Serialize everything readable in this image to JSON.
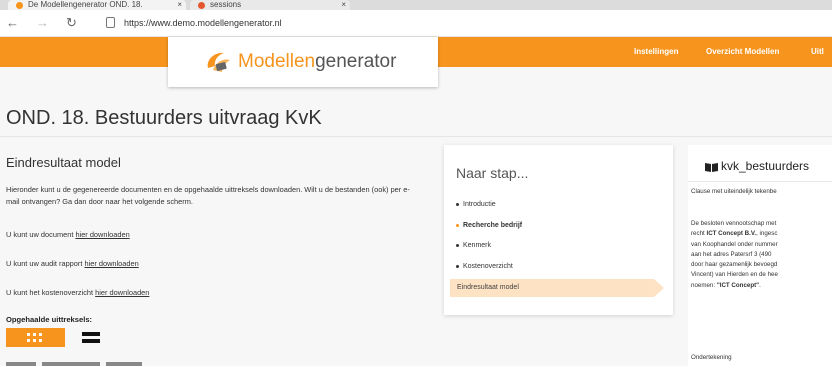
{
  "browser": {
    "tabs": [
      {
        "label": "De Modellengenerator OND. 18."
      },
      {
        "label": "sessions"
      }
    ],
    "url": "https://www.demo.modellengenerator.nl"
  },
  "nav": {
    "items": [
      "Instellingen",
      "Overzicht Modellen",
      "Uitl"
    ]
  },
  "logo": {
    "part1": "Modellen",
    "part2": "generator"
  },
  "page": {
    "title": "OND. 18. Bestuurders uitvraag KvK"
  },
  "main": {
    "heading": "Eindresultaat model",
    "intro": "Hieronder kunt u de gegenereerde documenten en de opgehaalde uittreksels downloaden. Wilt u de bestanden (ook) per e-mail ontvangen? Ga dan door naar het volgende scherm.",
    "downloads": [
      {
        "prefix": "U kunt uw document ",
        "link": "hier downloaden"
      },
      {
        "prefix": "U kunt uw audit rapport ",
        "link": "hier downloaden"
      },
      {
        "prefix": "U kunt het kostenoverzicht ",
        "link": "hier downloaden"
      }
    ],
    "extracts_label": "Opgehaalde uittreksels:"
  },
  "stap": {
    "title": "Naar stap...",
    "items": [
      "Introductie",
      "Recherche bedrijf",
      "Kenmerk",
      "Kostenoverzicht"
    ],
    "active": "Eindresultaat model"
  },
  "right": {
    "title": "kvk_bestuurders",
    "clause": "Clause met uiteindelijk tekenbe",
    "lines": [
      {
        "pre": "De besloten vennootschap met",
        "bold": "",
        "post": ""
      },
      {
        "pre": "recht ",
        "bold": "ICT Concept B.V.",
        "post": ", ingesc"
      },
      {
        "pre": "van Koophandel onder nummer",
        "bold": "",
        "post": ""
      },
      {
        "pre": "aan het adres Patersrf 3 (490",
        "bold": "",
        "post": ""
      },
      {
        "pre": "door haar gezamenlijk bevoegd",
        "bold": "",
        "post": ""
      },
      {
        "pre": "Vincent) van Hierden en de hee",
        "bold": "",
        "post": ""
      },
      {
        "pre": "noemen: ",
        "bold": "\"ICT Concept\"",
        "post": "."
      }
    ],
    "signature": "Ondertekening"
  },
  "colors": {
    "accent": "#f7941d",
    "active_step": "#fde2c4"
  }
}
